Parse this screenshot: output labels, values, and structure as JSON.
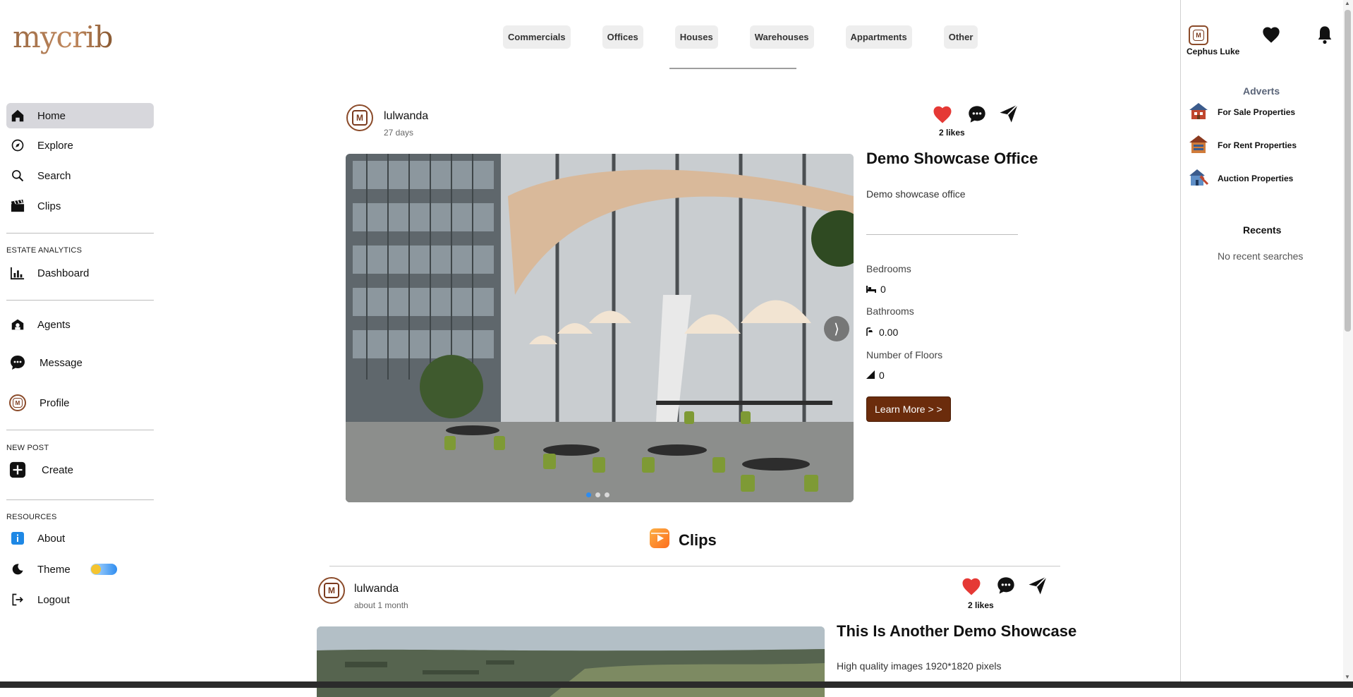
{
  "brand": {
    "logo_text": "mycrib"
  },
  "categories": [
    "Commercials",
    "Offices",
    "Houses",
    "Warehouses",
    "Appartments",
    "Other"
  ],
  "sidebar": {
    "main": [
      {
        "label": "Home",
        "icon": "home-icon",
        "active": true
      },
      {
        "label": "Explore",
        "icon": "compass-icon"
      },
      {
        "label": "Search",
        "icon": "search-icon"
      },
      {
        "label": "Clips",
        "icon": "clapperboard-icon"
      }
    ],
    "analytics_heading": "ESTATE ANALYTICS",
    "analytics": [
      {
        "label": "Dashboard",
        "icon": "bar-chart-icon"
      }
    ],
    "social": [
      {
        "label": "Agents",
        "icon": "agents-icon"
      },
      {
        "label": "Message",
        "icon": "chat-bubble-icon"
      },
      {
        "label": "Profile",
        "icon": "avatar-icon"
      }
    ],
    "new_post_heading": "NEW POST",
    "create": {
      "label": "Create",
      "icon": "plus-square-icon"
    },
    "resources_heading": "RESOURCES",
    "resources": [
      {
        "label": "About",
        "icon": "info-icon"
      },
      {
        "label": "Theme",
        "icon": "moon-icon"
      },
      {
        "label": "Logout",
        "icon": "logout-icon"
      }
    ]
  },
  "posts": [
    {
      "user": "lulwanda",
      "time": "27 days",
      "likes": "2 likes",
      "title": "Demo Showcase Office",
      "description": "Demo showcase office",
      "details": [
        {
          "label": "Bedrooms",
          "value": "0",
          "icon": "bed-icon"
        },
        {
          "label": "Bathrooms",
          "value": "0.00",
          "icon": "shower-icon"
        },
        {
          "label": "Number of Floors",
          "value": "0",
          "icon": "stairs-icon"
        }
      ],
      "cta": "Learn More > >",
      "slide_count": 3,
      "active_slide": 1
    },
    {
      "user": "lulwanda",
      "time": "about 1 month",
      "likes": "2 likes",
      "title": "This Is Another Demo Showcase",
      "description": "High quality images 1920*1820 pixels"
    }
  ],
  "clips": {
    "heading": "Clips"
  },
  "right_panel": {
    "user_name": "Cephus Luke",
    "adverts_heading": "Adverts",
    "adverts": [
      "For Sale Properties",
      "For Rent Properties",
      "Auction Properties"
    ],
    "recents_heading": "Recents",
    "recents_empty": "No recent searches"
  },
  "colors": {
    "accent_brown": "#6b2c0c",
    "like_red": "#e53935",
    "active_nav": "#d7d7dc",
    "adverts_heading": "#5a6478"
  }
}
